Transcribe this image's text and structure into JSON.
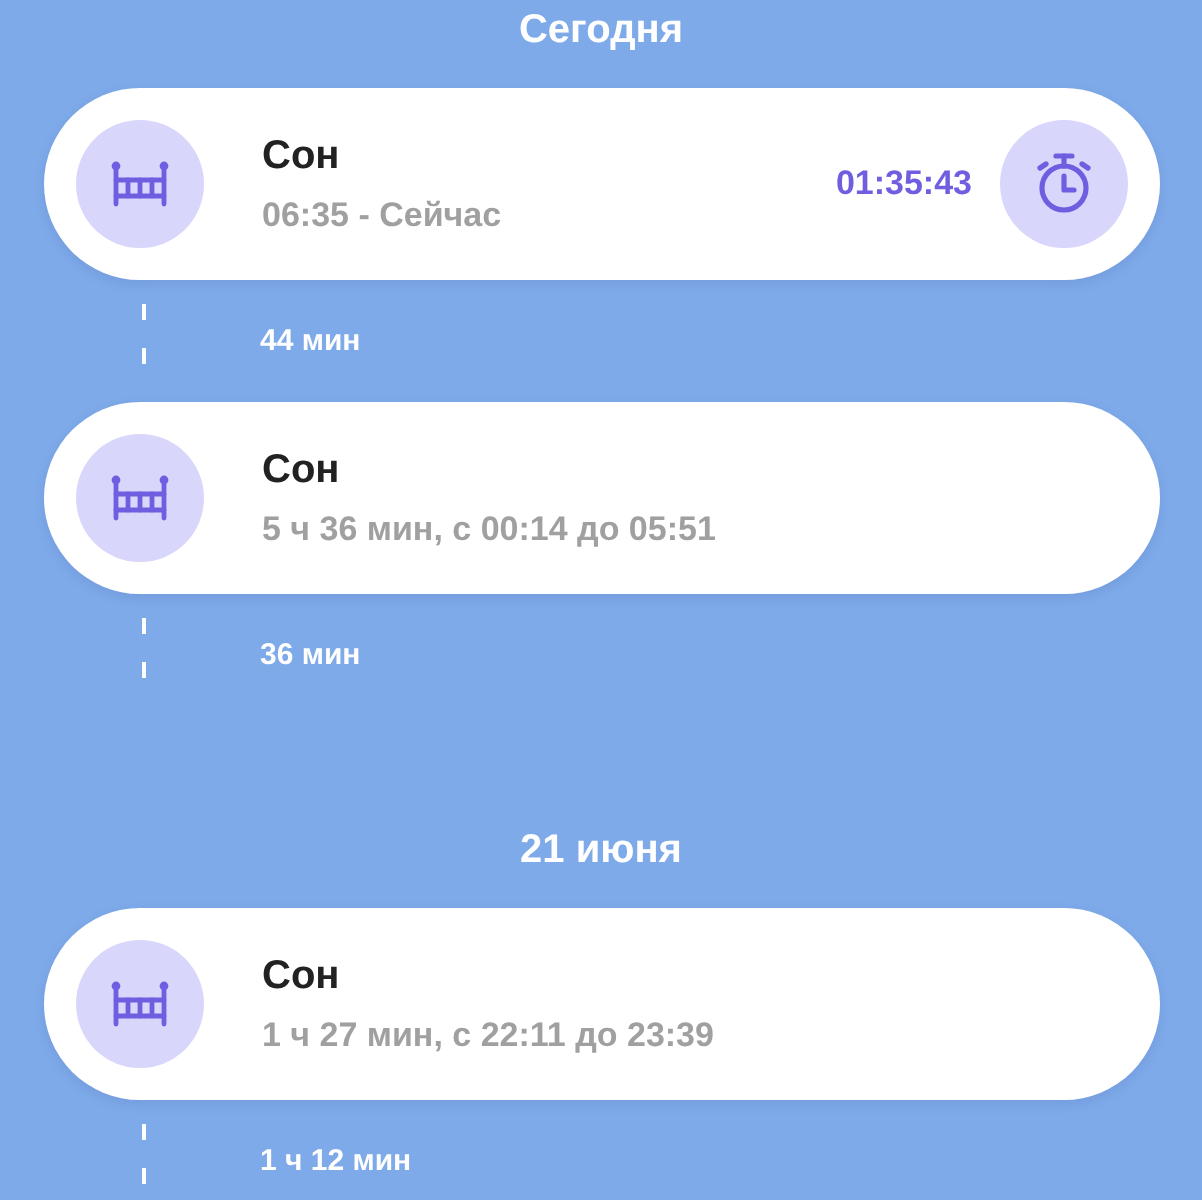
{
  "sections": [
    {
      "title": "Сегодня",
      "entries": [
        {
          "title": "Сон",
          "subtitle": "06:35 - Сейчас",
          "timer": "01:35:43",
          "gap": "44 мин"
        },
        {
          "title": "Сон",
          "subtitle": "5 ч 36 мин, с 00:14 до 05:51",
          "gap": "36 мин"
        }
      ]
    },
    {
      "title": "21 июня",
      "entries": [
        {
          "title": "Сон",
          "subtitle": "1 ч 27 мин, с 22:11 до 23:39",
          "gap": "1 ч 12 мин"
        }
      ]
    }
  ]
}
